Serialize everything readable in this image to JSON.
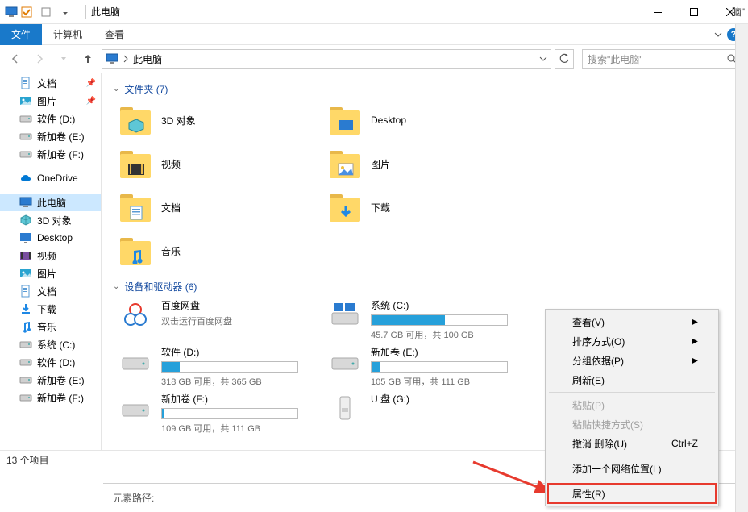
{
  "window": {
    "title": "此电脑"
  },
  "ribbon": {
    "tabs": [
      "文件",
      "计算机",
      "查看"
    ]
  },
  "address": {
    "location": "此电脑",
    "search_placeholder": "搜索\"此电脑\""
  },
  "sidebar": {
    "items": [
      {
        "label": "文档",
        "icon": "document",
        "pinned": true
      },
      {
        "label": "图片",
        "icon": "pictures",
        "pinned": true
      },
      {
        "label": "软件 (D:)",
        "icon": "drive"
      },
      {
        "label": "新加卷 (E:)",
        "icon": "drive"
      },
      {
        "label": "新加卷 (F:)",
        "icon": "drive"
      },
      {
        "spacer": true
      },
      {
        "label": "OneDrive",
        "icon": "onedrive"
      },
      {
        "spacer": true
      },
      {
        "label": "此电脑",
        "icon": "pc",
        "selected": true
      },
      {
        "label": "3D 对象",
        "icon": "3d"
      },
      {
        "label": "Desktop",
        "icon": "desktop"
      },
      {
        "label": "视频",
        "icon": "video"
      },
      {
        "label": "图片",
        "icon": "pictures"
      },
      {
        "label": "文档",
        "icon": "document"
      },
      {
        "label": "下载",
        "icon": "downloads"
      },
      {
        "label": "音乐",
        "icon": "music"
      },
      {
        "label": "系统 (C:)",
        "icon": "drive-c"
      },
      {
        "label": "软件 (D:)",
        "icon": "drive"
      },
      {
        "label": "新加卷 (E:)",
        "icon": "drive"
      },
      {
        "label": "新加卷 (F:)",
        "icon": "drive"
      },
      {
        "spacer": true
      }
    ]
  },
  "groups": {
    "folders": {
      "title": "文件夹 (7)",
      "items": [
        {
          "label": "3D 对象",
          "accent": "#5ec7d6"
        },
        {
          "label": "Desktop",
          "accent": "#2a7bd0"
        },
        {
          "label": "视频",
          "accent": "#7a4ea0"
        },
        {
          "label": "图片",
          "accent": "#2aa4d0"
        },
        {
          "label": "文档",
          "accent": "#4a90e2"
        },
        {
          "label": "下载",
          "accent": "#1e88e5"
        },
        {
          "label": "音乐",
          "accent": "#1e88e5"
        }
      ]
    },
    "drives": {
      "title": "设备和驱动器 (6)",
      "items": [
        {
          "label": "百度网盘",
          "sub": "双击运行百度网盘",
          "type": "app"
        },
        {
          "label": "系统 (C:)",
          "info": "45.7 GB 可用，共 100 GB",
          "fill": 54,
          "type": "os"
        },
        {
          "label": "软件 (D:)",
          "info": "318 GB 可用，共 365 GB",
          "fill": 13,
          "type": "hdd"
        },
        {
          "label": "新加卷 (E:)",
          "info": "105 GB 可用，共 111 GB",
          "fill": 6,
          "type": "hdd"
        },
        {
          "label": "新加卷 (F:)",
          "info": "109 GB 可用，共 111 GB",
          "fill": 2,
          "type": "hdd"
        },
        {
          "label": "U 盘 (G:)",
          "type": "usb"
        }
      ]
    }
  },
  "statusbar": {
    "text": "13 个项目"
  },
  "bottom": {
    "label": "元素路径:"
  },
  "context_menu": {
    "items": [
      {
        "label": "查看(V)",
        "submenu": true
      },
      {
        "label": "排序方式(O)",
        "submenu": true
      },
      {
        "label": "分组依据(P)",
        "submenu": true
      },
      {
        "label": "刷新(E)"
      },
      {
        "sep": true
      },
      {
        "label": "粘贴(P)",
        "disabled": true
      },
      {
        "label": "粘贴快捷方式(S)",
        "disabled": true
      },
      {
        "label": "撤消 删除(U)",
        "shortcut": "Ctrl+Z"
      },
      {
        "sep": true
      },
      {
        "label": "添加一个网络位置(L)"
      },
      {
        "sep": true
      },
      {
        "label": "属性(R)",
        "highlight": true
      }
    ]
  },
  "fragment_text": "脑\""
}
